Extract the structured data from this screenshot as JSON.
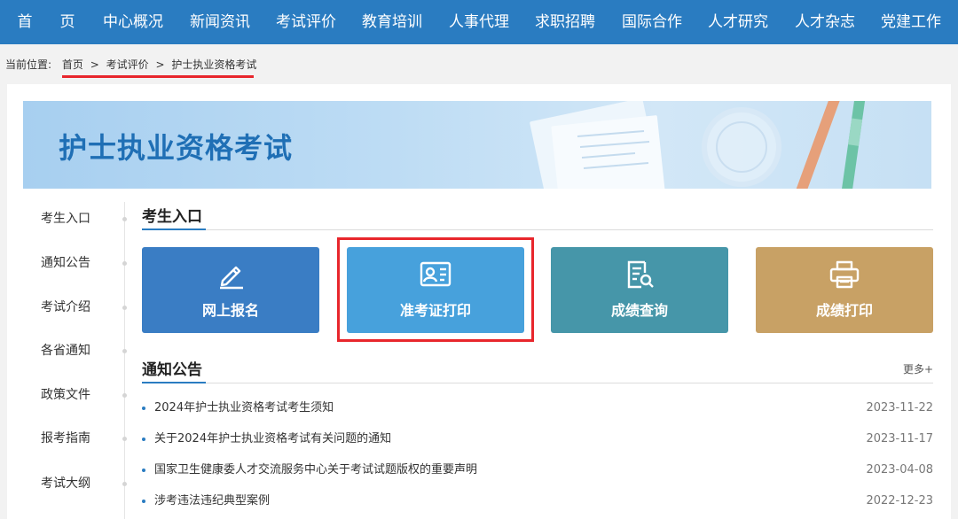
{
  "nav": {
    "items": [
      "首",
      "页",
      "中心概况",
      "新闻资讯",
      "考试评价",
      "教育培训",
      "人事代理",
      "求职招聘",
      "国际合作",
      "人才研究",
      "人才杂志",
      "党建工作"
    ]
  },
  "breadcrumb": {
    "prefix": "当前位置:",
    "items": [
      "首页",
      "考试评价",
      "护士执业资格考试"
    ],
    "separator": ">"
  },
  "banner": {
    "title": "护士执业资格考试"
  },
  "sidebar": {
    "items": [
      "考生入口",
      "通知公告",
      "考试介绍",
      "各省通知",
      "政策文件",
      "报考指南",
      "考试大纲"
    ]
  },
  "entrance": {
    "title": "考生入口",
    "tiles": [
      {
        "label": "网上报名",
        "icon": "pen-icon",
        "color": "#3a7dc4"
      },
      {
        "label": "准考证打印",
        "icon": "id-card-icon",
        "color": "#47a1dc"
      },
      {
        "label": "成绩查询",
        "icon": "document-search-icon",
        "color": "#4696a9"
      },
      {
        "label": "成绩打印",
        "icon": "printer-icon",
        "color": "#c8a165"
      }
    ]
  },
  "notices": {
    "title": "通知公告",
    "more": "更多+",
    "items": [
      {
        "title": "2024年护士执业资格考试考生须知",
        "date": "2023-11-22"
      },
      {
        "title": "关于2024年护士执业资格考试有关问题的通知",
        "date": "2023-11-17"
      },
      {
        "title": "国家卫生健康委人才交流服务中心关于考试试题版权的重要声明",
        "date": "2023-04-08"
      },
      {
        "title": "涉考违法违纪典型案例",
        "date": "2022-12-23"
      }
    ]
  },
  "colors": {
    "nav": "#2a7cc1",
    "highlight": "#e8262c"
  }
}
